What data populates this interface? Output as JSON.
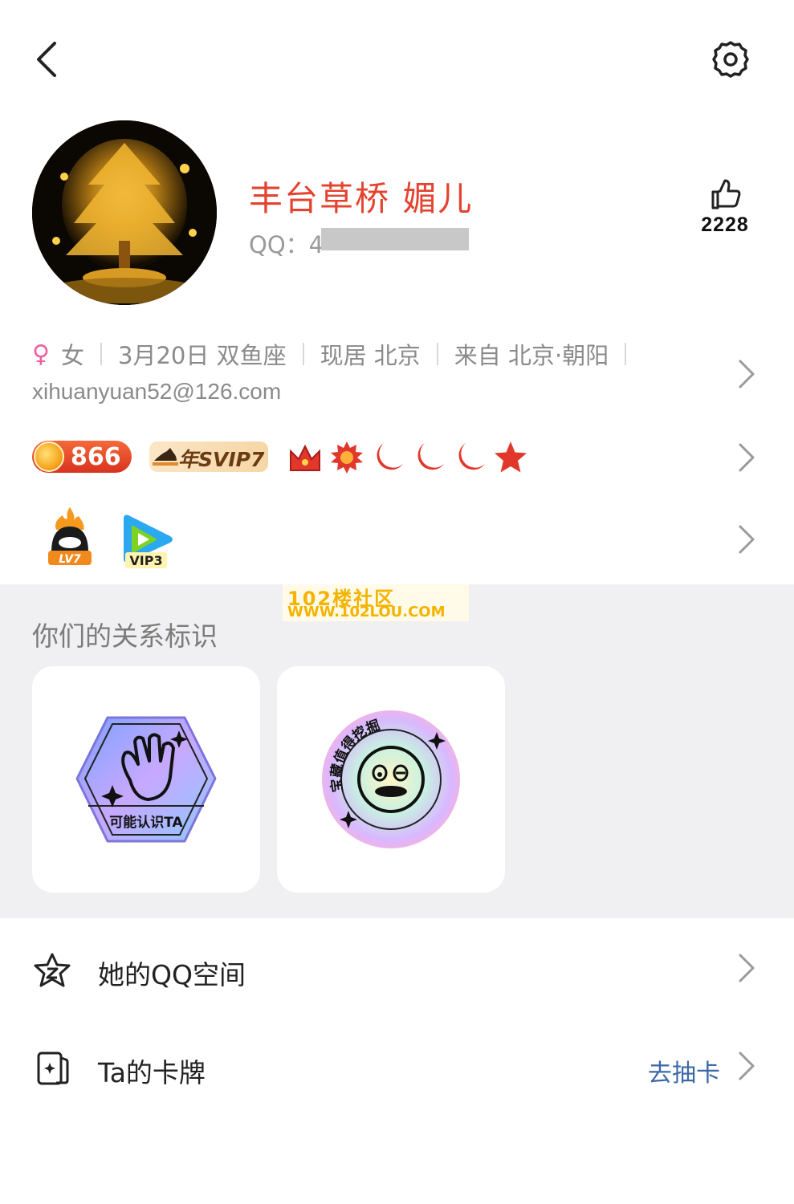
{
  "header": {
    "back_icon": "chevron-left-icon",
    "settings_icon": "gear-icon"
  },
  "profile": {
    "nickname": "丰台草桥 媚儿",
    "qq_label": "QQ：4",
    "likes": "2228",
    "like_icon": "thumbs-up-icon"
  },
  "info": {
    "gender_symbol": "♀",
    "gender": "女",
    "birthday": "3月20日 双鱼座",
    "residence": "现居 北京",
    "hometown": "来自 北京·朝阳",
    "email": "xihuanyuan52@126.com"
  },
  "badges": {
    "level": "866",
    "svip": "年SVIP7",
    "grade_icons": [
      "crown-icon",
      "sun-icon",
      "moon-icon",
      "moon-icon",
      "moon-icon",
      "star-icon"
    ]
  },
  "app_badges": {
    "qq_level": "LV7",
    "video_vip": "VIP3"
  },
  "relation": {
    "title": "你们的关系标识",
    "cards": [
      {
        "label": "可能认识TA",
        "icon": "wave-hand-icon"
      },
      {
        "label": "宝藏值得挖掘",
        "icon": "smiley-face-icon"
      }
    ]
  },
  "watermark": {
    "line1": "102楼社区",
    "line2": "WWW.102LOU.COM"
  },
  "list": [
    {
      "label": "她的QQ空间",
      "icon": "qzone-star-icon",
      "action": ""
    },
    {
      "label": "Ta的卡牌",
      "icon": "card-icon",
      "action": "去抽卡"
    }
  ],
  "colors": {
    "nickname": "#e3432f",
    "link": "#3c68a8",
    "section_bg": "#f0f0f2"
  }
}
